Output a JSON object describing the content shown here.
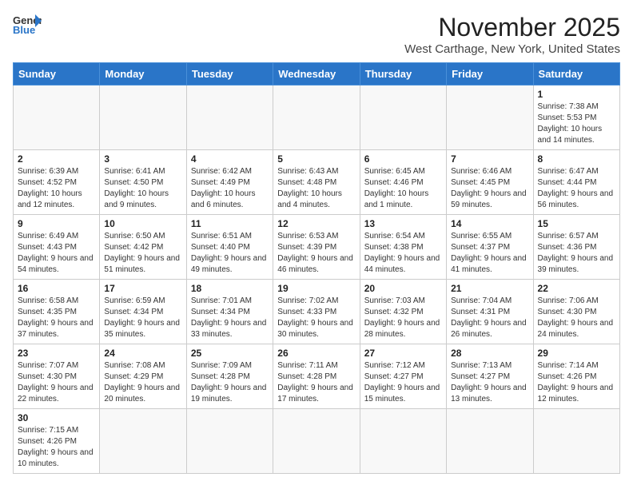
{
  "header": {
    "logo_line1": "General",
    "logo_line2": "Blue",
    "month": "November 2025",
    "location": "West Carthage, New York, United States"
  },
  "weekdays": [
    "Sunday",
    "Monday",
    "Tuesday",
    "Wednesday",
    "Thursday",
    "Friday",
    "Saturday"
  ],
  "weeks": [
    [
      {
        "day": "",
        "info": ""
      },
      {
        "day": "",
        "info": ""
      },
      {
        "day": "",
        "info": ""
      },
      {
        "day": "",
        "info": ""
      },
      {
        "day": "",
        "info": ""
      },
      {
        "day": "",
        "info": ""
      },
      {
        "day": "1",
        "info": "Sunrise: 7:38 AM\nSunset: 5:53 PM\nDaylight: 10 hours and 14 minutes."
      }
    ],
    [
      {
        "day": "2",
        "info": "Sunrise: 6:39 AM\nSunset: 4:52 PM\nDaylight: 10 hours and 12 minutes."
      },
      {
        "day": "3",
        "info": "Sunrise: 6:41 AM\nSunset: 4:50 PM\nDaylight: 10 hours and 9 minutes."
      },
      {
        "day": "4",
        "info": "Sunrise: 6:42 AM\nSunset: 4:49 PM\nDaylight: 10 hours and 6 minutes."
      },
      {
        "day": "5",
        "info": "Sunrise: 6:43 AM\nSunset: 4:48 PM\nDaylight: 10 hours and 4 minutes."
      },
      {
        "day": "6",
        "info": "Sunrise: 6:45 AM\nSunset: 4:46 PM\nDaylight: 10 hours and 1 minute."
      },
      {
        "day": "7",
        "info": "Sunrise: 6:46 AM\nSunset: 4:45 PM\nDaylight: 9 hours and 59 minutes."
      },
      {
        "day": "8",
        "info": "Sunrise: 6:47 AM\nSunset: 4:44 PM\nDaylight: 9 hours and 56 minutes."
      }
    ],
    [
      {
        "day": "9",
        "info": "Sunrise: 6:49 AM\nSunset: 4:43 PM\nDaylight: 9 hours and 54 minutes."
      },
      {
        "day": "10",
        "info": "Sunrise: 6:50 AM\nSunset: 4:42 PM\nDaylight: 9 hours and 51 minutes."
      },
      {
        "day": "11",
        "info": "Sunrise: 6:51 AM\nSunset: 4:40 PM\nDaylight: 9 hours and 49 minutes."
      },
      {
        "day": "12",
        "info": "Sunrise: 6:53 AM\nSunset: 4:39 PM\nDaylight: 9 hours and 46 minutes."
      },
      {
        "day": "13",
        "info": "Sunrise: 6:54 AM\nSunset: 4:38 PM\nDaylight: 9 hours and 44 minutes."
      },
      {
        "day": "14",
        "info": "Sunrise: 6:55 AM\nSunset: 4:37 PM\nDaylight: 9 hours and 41 minutes."
      },
      {
        "day": "15",
        "info": "Sunrise: 6:57 AM\nSunset: 4:36 PM\nDaylight: 9 hours and 39 minutes."
      }
    ],
    [
      {
        "day": "16",
        "info": "Sunrise: 6:58 AM\nSunset: 4:35 PM\nDaylight: 9 hours and 37 minutes."
      },
      {
        "day": "17",
        "info": "Sunrise: 6:59 AM\nSunset: 4:34 PM\nDaylight: 9 hours and 35 minutes."
      },
      {
        "day": "18",
        "info": "Sunrise: 7:01 AM\nSunset: 4:34 PM\nDaylight: 9 hours and 33 minutes."
      },
      {
        "day": "19",
        "info": "Sunrise: 7:02 AM\nSunset: 4:33 PM\nDaylight: 9 hours and 30 minutes."
      },
      {
        "day": "20",
        "info": "Sunrise: 7:03 AM\nSunset: 4:32 PM\nDaylight: 9 hours and 28 minutes."
      },
      {
        "day": "21",
        "info": "Sunrise: 7:04 AM\nSunset: 4:31 PM\nDaylight: 9 hours and 26 minutes."
      },
      {
        "day": "22",
        "info": "Sunrise: 7:06 AM\nSunset: 4:30 PM\nDaylight: 9 hours and 24 minutes."
      }
    ],
    [
      {
        "day": "23",
        "info": "Sunrise: 7:07 AM\nSunset: 4:30 PM\nDaylight: 9 hours and 22 minutes."
      },
      {
        "day": "24",
        "info": "Sunrise: 7:08 AM\nSunset: 4:29 PM\nDaylight: 9 hours and 20 minutes."
      },
      {
        "day": "25",
        "info": "Sunrise: 7:09 AM\nSunset: 4:28 PM\nDaylight: 9 hours and 19 minutes."
      },
      {
        "day": "26",
        "info": "Sunrise: 7:11 AM\nSunset: 4:28 PM\nDaylight: 9 hours and 17 minutes."
      },
      {
        "day": "27",
        "info": "Sunrise: 7:12 AM\nSunset: 4:27 PM\nDaylight: 9 hours and 15 minutes."
      },
      {
        "day": "28",
        "info": "Sunrise: 7:13 AM\nSunset: 4:27 PM\nDaylight: 9 hours and 13 minutes."
      },
      {
        "day": "29",
        "info": "Sunrise: 7:14 AM\nSunset: 4:26 PM\nDaylight: 9 hours and 12 minutes."
      }
    ],
    [
      {
        "day": "30",
        "info": "Sunrise: 7:15 AM\nSunset: 4:26 PM\nDaylight: 9 hours and 10 minutes."
      },
      {
        "day": "",
        "info": ""
      },
      {
        "day": "",
        "info": ""
      },
      {
        "day": "",
        "info": ""
      },
      {
        "day": "",
        "info": ""
      },
      {
        "day": "",
        "info": ""
      },
      {
        "day": "",
        "info": ""
      }
    ]
  ]
}
